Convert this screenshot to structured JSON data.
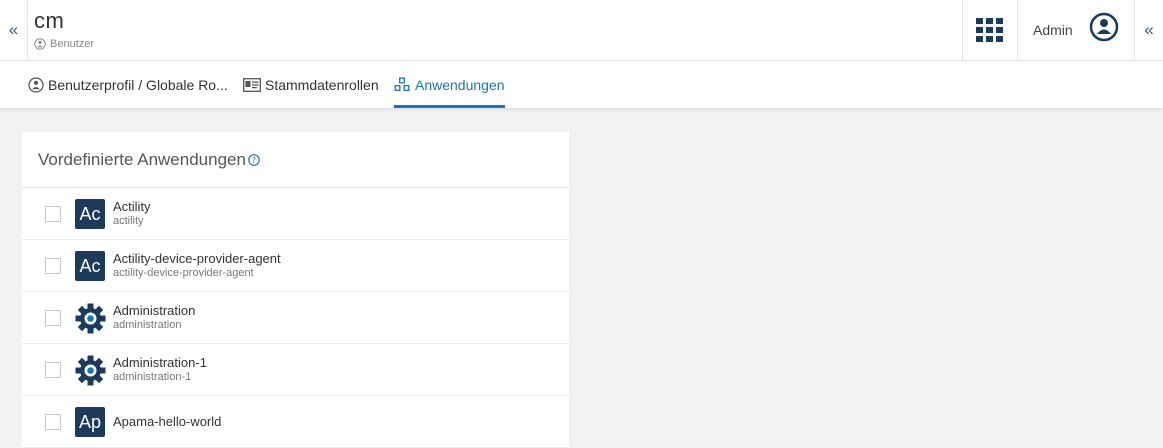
{
  "header": {
    "collapse_left": "«",
    "title": "cm",
    "subtitle": "Benutzer",
    "user_name": "Admin",
    "collapse_right": "«"
  },
  "tabs": [
    {
      "label": "Benutzerprofil / Globale Ro...",
      "icon": "user-circle-icon",
      "active": false
    },
    {
      "label": "Stammdatenrollen",
      "icon": "id-card-icon",
      "active": false
    },
    {
      "label": "Anwendungen",
      "icon": "cubes-icon",
      "active": true
    }
  ],
  "panel": {
    "title": "Vordefinierte Anwendungen",
    "apps": [
      {
        "name": "Actility",
        "id": "actility",
        "icon": "badge",
        "badge": "Ac"
      },
      {
        "name": "Actility-device-provider-agent",
        "id": "actility-device-provider-agent",
        "icon": "badge",
        "badge": "Ac"
      },
      {
        "name": "Administration",
        "id": "administration",
        "icon": "gear"
      },
      {
        "name": "Administration-1",
        "id": "administration-1",
        "icon": "gear"
      },
      {
        "name": "Apama-hello-world",
        "id": "",
        "icon": "badge",
        "badge": "Ap"
      }
    ]
  },
  "colors": {
    "accent": "#1776bf",
    "badge_bg": "#1b3a5c",
    "page_bg": "#f2f2f3"
  }
}
